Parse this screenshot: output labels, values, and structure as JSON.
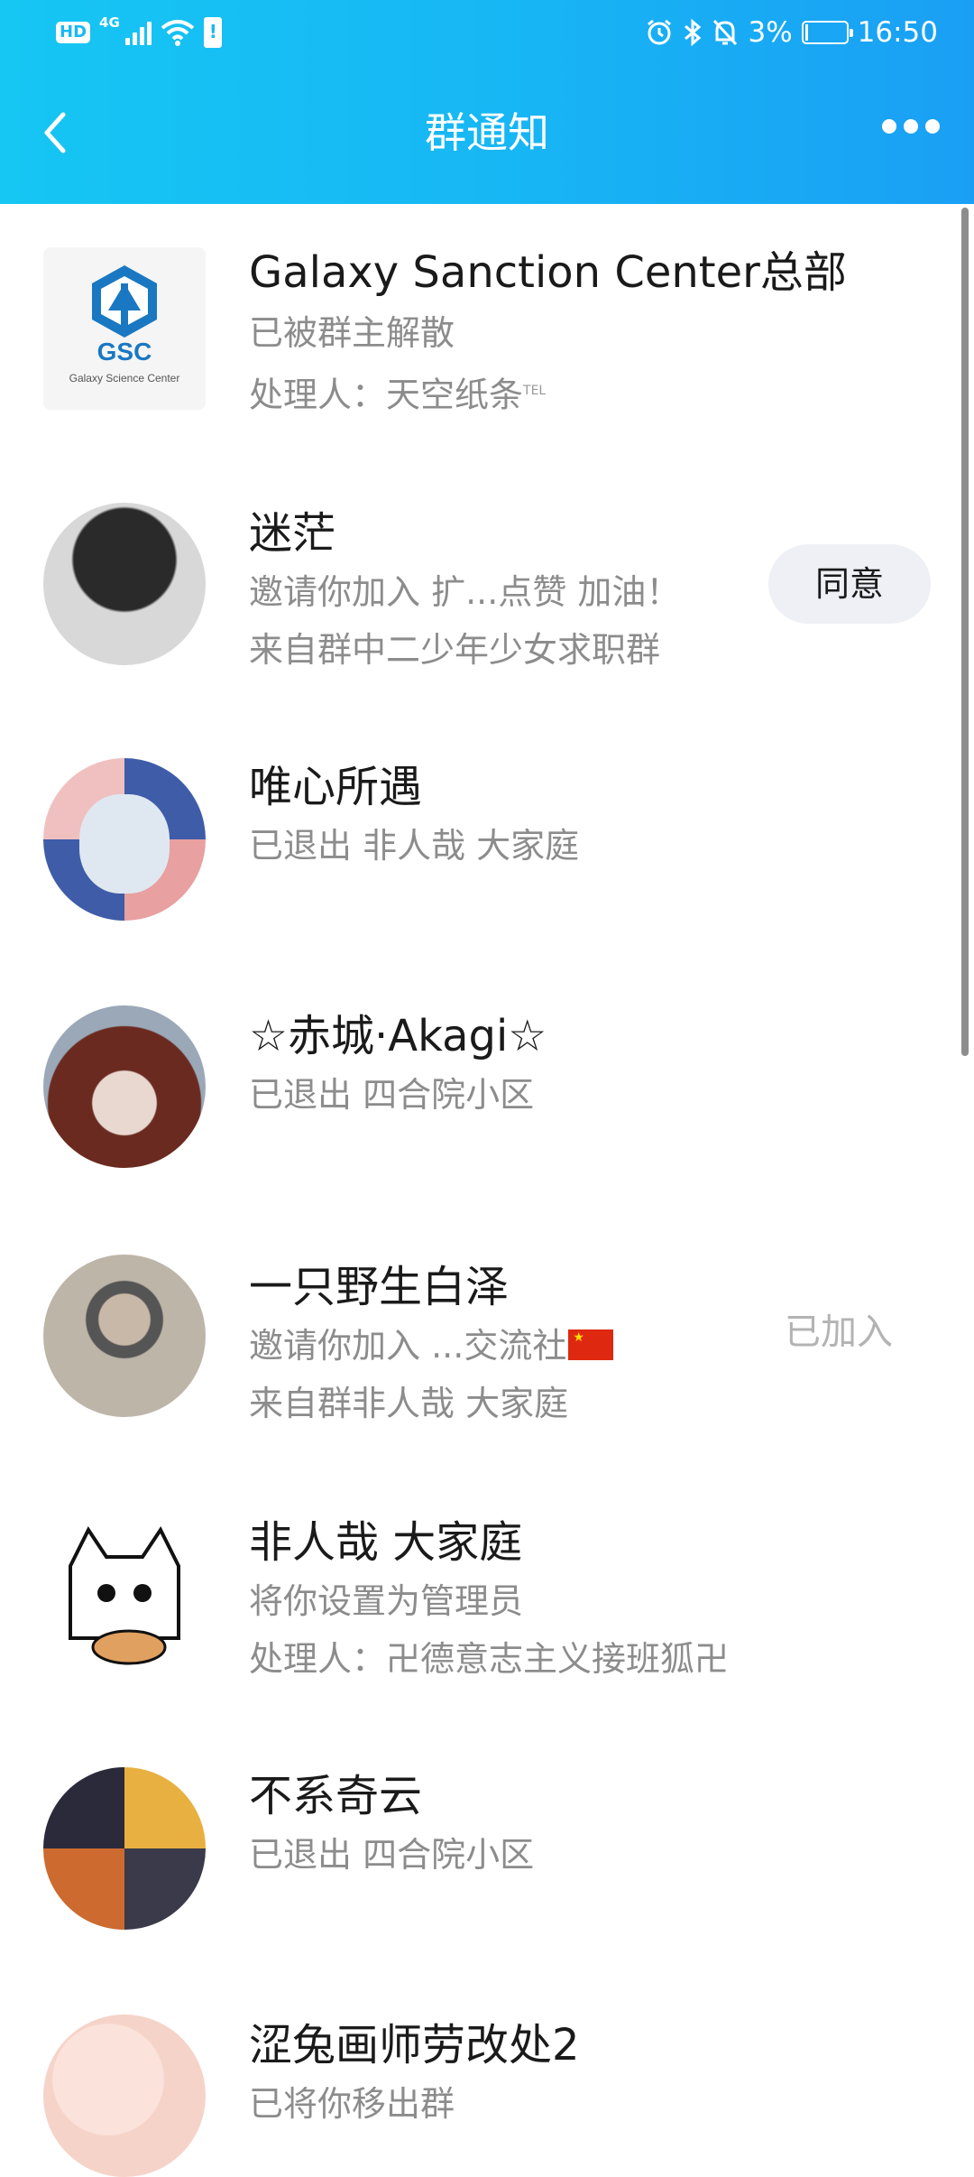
{
  "status_bar": {
    "hd": "HD",
    "network": "4G",
    "battery_percent": "3%",
    "time": "16:50"
  },
  "nav": {
    "title": "群通知"
  },
  "notifications": [
    {
      "title": "Galaxy Sanction Center总部",
      "line1": "已被群主解散",
      "line2": "处理人：天空纸条",
      "line2_sup": "TEL",
      "avatar_text": "GSC",
      "avatar_subtext": "Galaxy Science Center"
    },
    {
      "title": "迷茫",
      "line1": "邀请你加入 扩...点赞 加油！",
      "line2": "来自群中二少年少女求职群",
      "action": "同意"
    },
    {
      "title": "唯心所遇",
      "line1": "已退出 非人哉 大家庭"
    },
    {
      "title": "☆赤城·Akagi☆",
      "line1": "已退出 四合院小区"
    },
    {
      "title": "一只野生白泽",
      "line1": "邀请你加入 ...交流社",
      "line2": "来自群非人哉 大家庭",
      "status": "已加入"
    },
    {
      "title": "非人哉 大家庭",
      "line1": "将你设置为管理员",
      "line2": "处理人：卍德意志主义接班狐卍"
    },
    {
      "title": "不系奇云",
      "line1": "已退出 四合院小区"
    },
    {
      "title": "涩兔画师劳改处2",
      "line1": "已将你移出群"
    }
  ],
  "colors": {
    "header_start": "#16c6f3",
    "header_end": "#1a9ff4",
    "title_text": "#1a1a1a",
    "sub_text": "#8c8c8c",
    "button_bg": "#eef0f5"
  }
}
